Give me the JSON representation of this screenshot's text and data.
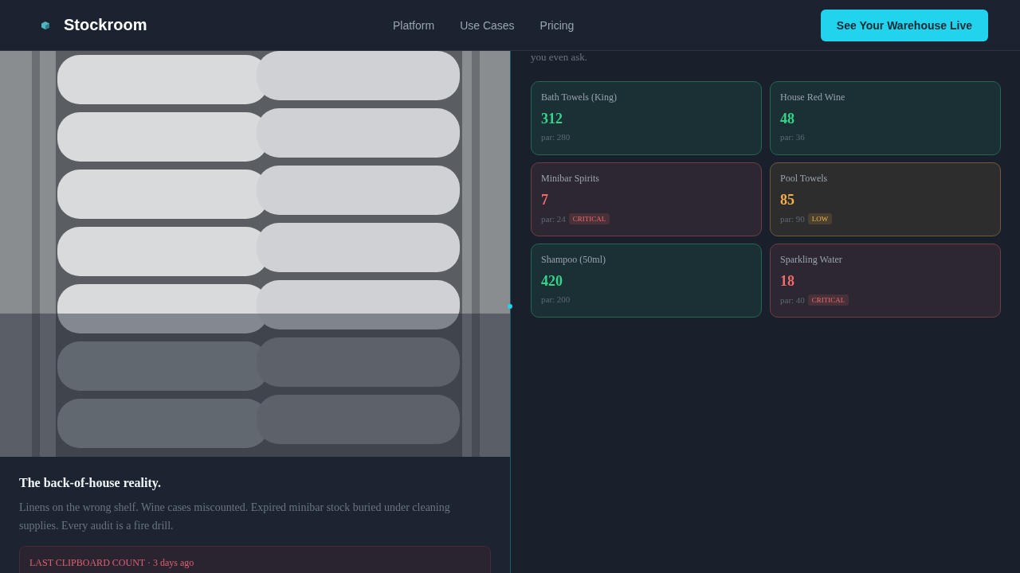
{
  "nav": {
    "brand": "Stockroom",
    "links": [
      "Platform",
      "Use Cases",
      "Pricing"
    ],
    "cta": "See Your Warehouse Live"
  },
  "left": {
    "heading": "The back-of-house reality.",
    "body": "Linens on the wrong shelf. Wine cases miscounted. Expired minibar stock buried under cleaning supplies. Every audit is a fire drill.",
    "note": "LAST CLIPBOARD COUNT · 3 days ago"
  },
  "right": {
    "intro": "you even ask.",
    "items": [
      {
        "name": "Bath Towels (King)",
        "count": "312",
        "par": "par: 280",
        "color": "#34d58a"
      },
      {
        "name": "House Red Wine",
        "count": "48",
        "par": "par: 36",
        "color": "#34d58a"
      },
      {
        "name": "Minibar Spirits",
        "count": "7",
        "par": "par: 24",
        "color": "#f06b6b",
        "badge": "CRITICAL"
      },
      {
        "name": "Pool Towels",
        "count": "85",
        "par": "par: 90",
        "color": "#f5b04a",
        "badge": "LOW"
      },
      {
        "name": "Shampoo (50ml)",
        "count": "420",
        "par": "par: 200",
        "color": "#34d58a"
      },
      {
        "name": "Sparkling Water",
        "count": "18",
        "par": "par: 40",
        "color": "#f06b6b",
        "badge": "CRITICAL"
      }
    ]
  }
}
